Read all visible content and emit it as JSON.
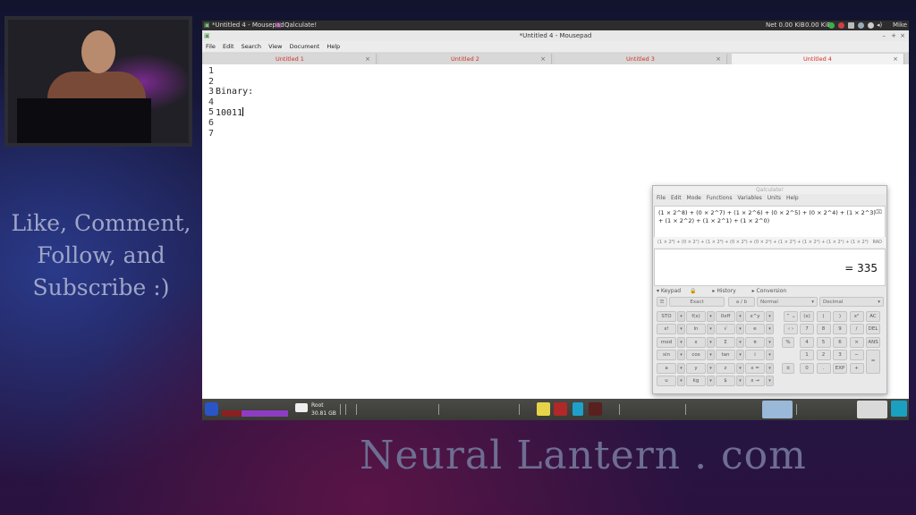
{
  "overlay": {
    "promo_lines": [
      "Like, Comment,",
      "Follow, and",
      "Subscribe :)"
    ],
    "brand": "Neural Lantern . com"
  },
  "topbar": {
    "active_window": "*Untitled 4 - Mousepad",
    "other_window": "Qalculate!",
    "net": "Net 0.00 KiB",
    "net2": "0.00 KiB",
    "user": "Mike"
  },
  "mousepad": {
    "title": "*Untitled 4 - Mousepad",
    "menu": [
      "File",
      "Edit",
      "Search",
      "View",
      "Document",
      "Help"
    ],
    "tabs": [
      {
        "label": "Untitled 1",
        "active": false
      },
      {
        "label": "Untitled 2",
        "active": false
      },
      {
        "label": "Untitled 3",
        "active": false
      },
      {
        "label": "Untitled 4",
        "active": true
      }
    ],
    "line_numbers": [
      "1",
      "2",
      "3",
      "4",
      "5",
      "6",
      "7"
    ],
    "lines": [
      "",
      "",
      "Binary:",
      "",
      "10011",
      "",
      ""
    ]
  },
  "qalculate": {
    "title": "Qalculate!",
    "menu": [
      "File",
      "Edit",
      "Mode",
      "Functions",
      "Variables",
      "Units",
      "Help"
    ],
    "expression": "(1 × 2^8) + (0 × 2^7) + (1 × 2^6) + (0 × 2^5) + (0 × 2^4) + (1 × 2^3) + (1 × 2^2) + (1 × 2^1) + (1 × 2^0)",
    "parsed": "(1 × 2⁸) + (0 × 2⁷) + (1 × 2⁶) + (0 × 2⁵) + (0 × 2⁴) + (1 × 2³) + (1 × 2²) + (1 × 2¹) + (1 × 2⁰)",
    "angle_unit": "RAD",
    "result": "= 335",
    "panel_tabs": [
      "Keypad",
      "History",
      "Conversion"
    ],
    "options": {
      "exact": "Exact",
      "fraction": "a / b",
      "mode": "Normal",
      "base": "Decimal"
    },
    "sci_keys": [
      [
        "STO",
        "f(x)",
        "0xff",
        "x^y"
      ],
      [
        "x!",
        "ln",
        "√",
        "e"
      ],
      [
        "mod",
        "x",
        "Σ",
        "π"
      ],
      [
        "sin",
        "cos",
        "tan",
        "i"
      ],
      [
        "a",
        "y",
        "z",
        "x ="
      ],
      [
        "u",
        "kg",
        "$",
        "x →"
      ]
    ],
    "num_keys": [
      [
        "(x)",
        "(",
        ")",
        "x²",
        "AC"
      ],
      [
        "7",
        "8",
        "9",
        "/",
        "DEL"
      ],
      [
        "4",
        "5",
        "6",
        "×",
        "ANS"
      ],
      [
        "1",
        "2",
        "3",
        "−",
        "="
      ],
      [
        "0",
        ".",
        "EXP",
        "+",
        ""
      ]
    ],
    "side_keys": [
      "%",
      "±"
    ]
  },
  "taskbar": {
    "disk_label": "Root",
    "disk_free": "30.81 GB"
  }
}
